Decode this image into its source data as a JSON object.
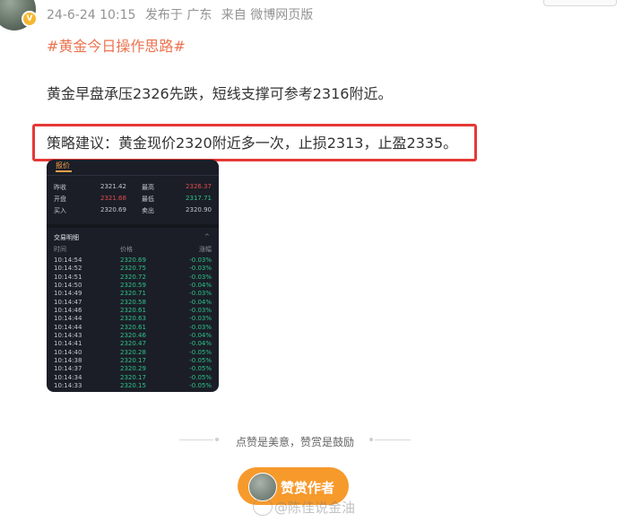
{
  "post": {
    "date": "24-6-24 10:15",
    "location": "发布于 广东",
    "source": "来自 微博网页版",
    "topic": "#黄金今日操作思路#",
    "line1": "黄金早盘承压2326先跌，短线支撑可参考2316附近。",
    "line2": "策略建议：黄金现价2320附近多一次，止损2313，止盈2335。"
  },
  "quote_image": {
    "tab": "报价",
    "rows": [
      {
        "l1": "昨收",
        "v1": "2321.42",
        "l2": "最高",
        "v2": "2326.37",
        "c1": "",
        "c2": "red"
      },
      {
        "l1": "开盘",
        "v1": "2321.68",
        "l2": "最低",
        "v2": "2317.71",
        "c1": "red",
        "c2": "green"
      },
      {
        "l1": "买入",
        "v1": "2320.69",
        "l2": "卖出",
        "v2": "2320.90",
        "c1": "",
        "c2": ""
      }
    ],
    "section": "交易明细",
    "headers": {
      "time": "时间",
      "price": "价格",
      "change": "涨幅"
    },
    "trades": [
      {
        "time": "10:14:54",
        "price": "2320.69",
        "change": "-0.03%"
      },
      {
        "time": "10:14:52",
        "price": "2320.75",
        "change": "-0.03%"
      },
      {
        "time": "10:14:51",
        "price": "2320.72",
        "change": "-0.03%"
      },
      {
        "time": "10:14:50",
        "price": "2320.59",
        "change": "-0.04%"
      },
      {
        "time": "10:14:49",
        "price": "2320.71",
        "change": "-0.03%"
      },
      {
        "time": "10:14:47",
        "price": "2320.58",
        "change": "-0.04%"
      },
      {
        "time": "10:14:46",
        "price": "2320.61",
        "change": "-0.03%"
      },
      {
        "time": "10:14:44",
        "price": "2320.63",
        "change": "-0.03%"
      },
      {
        "time": "10:14:44",
        "price": "2320.61",
        "change": "-0.03%"
      },
      {
        "time": "10:14:43",
        "price": "2320.46",
        "change": "-0.04%"
      },
      {
        "time": "10:14:41",
        "price": "2320.47",
        "change": "-0.04%"
      },
      {
        "time": "10:14:40",
        "price": "2320.28",
        "change": "-0.05%"
      },
      {
        "time": "10:14:38",
        "price": "2320.17",
        "change": "-0.05%"
      },
      {
        "time": "10:14:37",
        "price": "2320.29",
        "change": "-0.05%"
      },
      {
        "time": "10:14:34",
        "price": "2320.17",
        "change": "-0.05%"
      },
      {
        "time": "10:14:33",
        "price": "2320.15",
        "change": "-0.05%"
      }
    ]
  },
  "reward": {
    "divider_text": "点赞是美意，赞赏是鼓励",
    "button_label": "赞赏作者"
  },
  "watermark": "@陈佳说金油",
  "colors": {
    "topic": "#eb7350",
    "highlight_border": "#e53935",
    "reward_button": "#f79a2c"
  }
}
